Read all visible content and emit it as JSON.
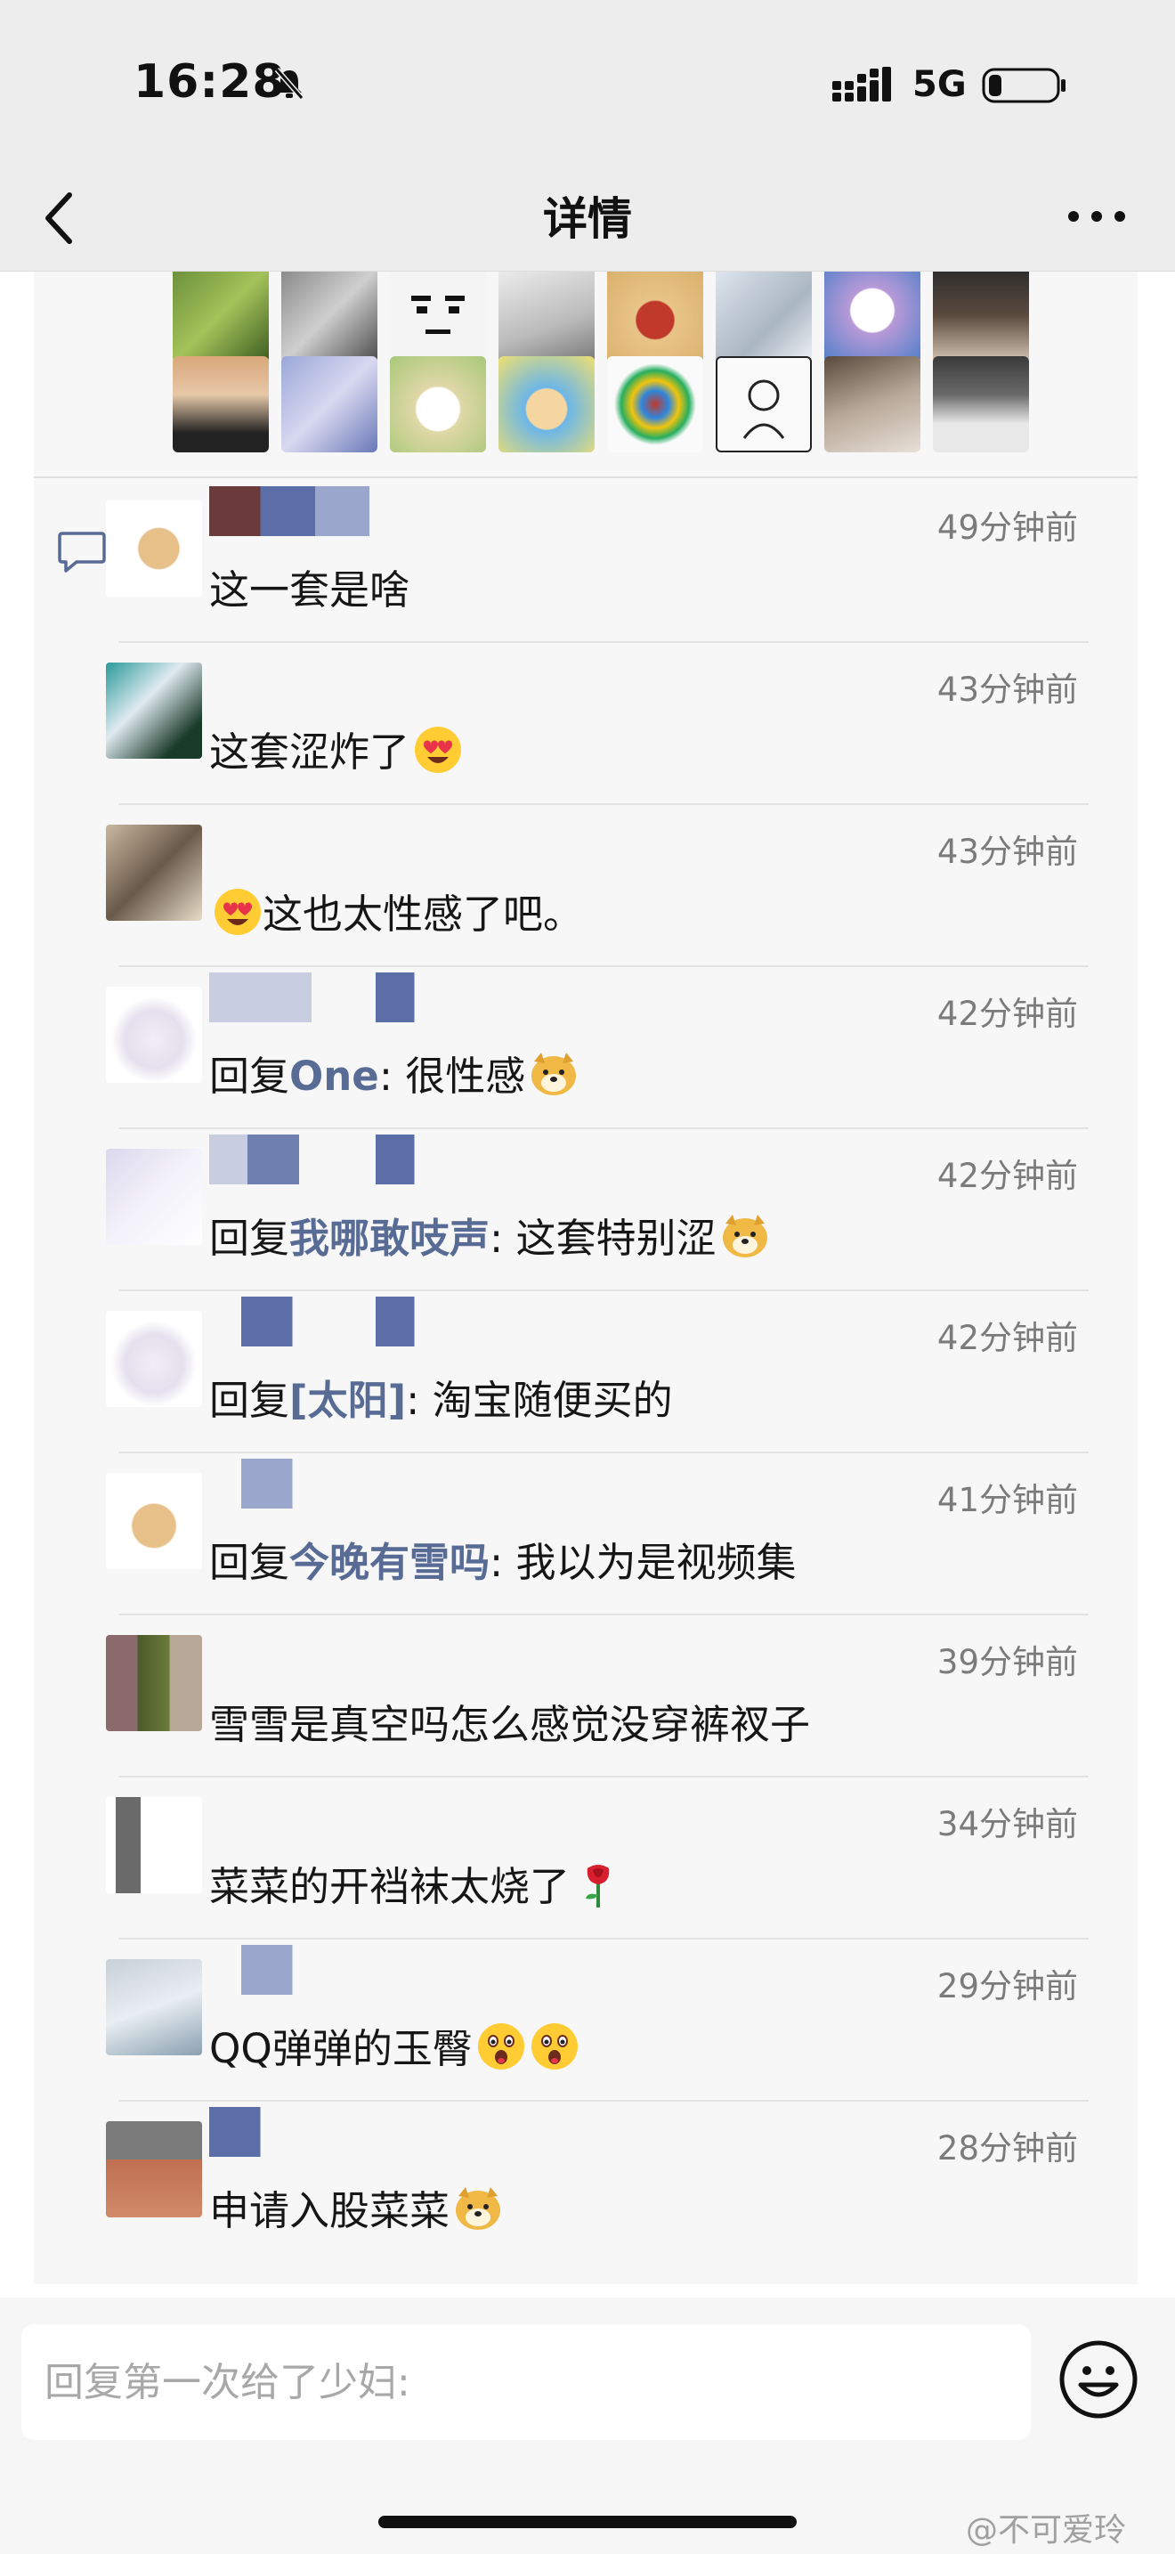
{
  "status_bar": {
    "time": "16:28",
    "network": "5G",
    "icons": [
      "bell-muted-icon",
      "signal-icon",
      "battery-icon"
    ]
  },
  "nav": {
    "title": "详情",
    "back_icon": "chevron-left-icon",
    "more_icon": "more-dots-icon"
  },
  "liked_avatars": {
    "count": 16
  },
  "comments": [
    {
      "time": "49分钟前",
      "parts": [
        {
          "t": "这一套是啥"
        }
      ]
    },
    {
      "time": "43分钟前",
      "parts": [
        {
          "t": "这套涩炸了"
        },
        {
          "e": "heart-eyes-emoji"
        }
      ]
    },
    {
      "time": "43分钟前",
      "parts": [
        {
          "e": "heart-eyes-emoji"
        },
        {
          "t": "这也太性感了吧。"
        }
      ]
    },
    {
      "time": "42分钟前",
      "parts": [
        {
          "t": "回复"
        },
        {
          "r": "One"
        },
        {
          "t": ": 很性感"
        },
        {
          "e": "doge-emoji"
        }
      ]
    },
    {
      "time": "42分钟前",
      "parts": [
        {
          "t": "回复"
        },
        {
          "r": "我哪敢吱声"
        },
        {
          "t": ": 这套特别涩"
        },
        {
          "e": "doge-emoji"
        }
      ]
    },
    {
      "time": "42分钟前",
      "parts": [
        {
          "t": "回复"
        },
        {
          "r": "[太阳]"
        },
        {
          "t": ": 淘宝随便买的"
        }
      ]
    },
    {
      "time": "41分钟前",
      "parts": [
        {
          "t": "回复"
        },
        {
          "r": "今晚有雪吗"
        },
        {
          "t": ": 我以为是视频集"
        }
      ]
    },
    {
      "time": "39分钟前",
      "parts": [
        {
          "t": "雪雪是真空吗怎么感觉没穿裤衩子"
        }
      ]
    },
    {
      "time": "34分钟前",
      "parts": [
        {
          "t": "菜菜的开裆袜太烧了"
        },
        {
          "e": "rose-emoji"
        }
      ]
    },
    {
      "time": "29分钟前",
      "parts": [
        {
          "t": "QQ弹弹的玉臀"
        },
        {
          "e": "surprised-emoji"
        },
        {
          "e": "surprised-emoji"
        }
      ]
    },
    {
      "time": "28分钟前",
      "parts": [
        {
          "t": "申请入股菜菜"
        },
        {
          "e": "doge-emoji"
        }
      ]
    }
  ],
  "reply_bar": {
    "placeholder": "回复第一次给了少妇:",
    "emoji_icon": "smile-face-icon"
  },
  "watermark": "@不可爱玲",
  "colors": {
    "link": "#576b95",
    "background": "#ededed",
    "card": "#f7f7f7"
  }
}
